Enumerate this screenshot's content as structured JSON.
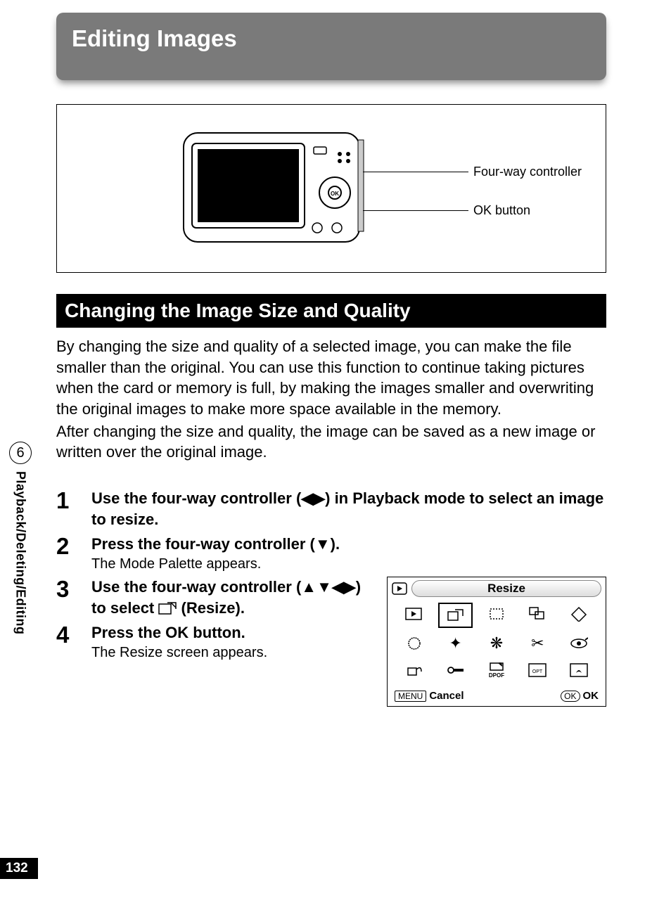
{
  "chapter_title": "Editing Images",
  "callouts": {
    "four_way": "Four-way controller",
    "ok_button": "OK button"
  },
  "section_title": "Changing the Image Size and Quality",
  "intro_p1": "By changing the size and quality of a selected image, you can make the file smaller than the original. You can use this function to continue taking pictures when the card or memory is full, by making the images smaller and overwriting the original images to make more space available in the memory.",
  "intro_p2": "After changing the size and quality, the image can be saved as a new image or written over the original image.",
  "steps": {
    "s1": {
      "num": "1",
      "title_a": "Use the four-way controller (",
      "title_b": ") in Playback mode to select an image to resize."
    },
    "s2": {
      "num": "2",
      "title_a": "Press the four-way controller (",
      "title_b": ").",
      "desc": "The Mode Palette appears."
    },
    "s3": {
      "num": "3",
      "title_a": "Use the four-way controller (",
      "title_b": ") to select ",
      "title_c": " (Resize)."
    },
    "s4": {
      "num": "4",
      "title": "Press the OK button.",
      "desc": "The Resize screen appears."
    }
  },
  "palette": {
    "title": "Resize",
    "menu_label": "MENU",
    "cancel": "Cancel",
    "ok_label": "OK",
    "ok_btn": "OK",
    "dpof": "DPOF"
  },
  "side": {
    "chapter_num": "6",
    "label": "Playback/Deleting/Editing"
  },
  "page_number": "132"
}
